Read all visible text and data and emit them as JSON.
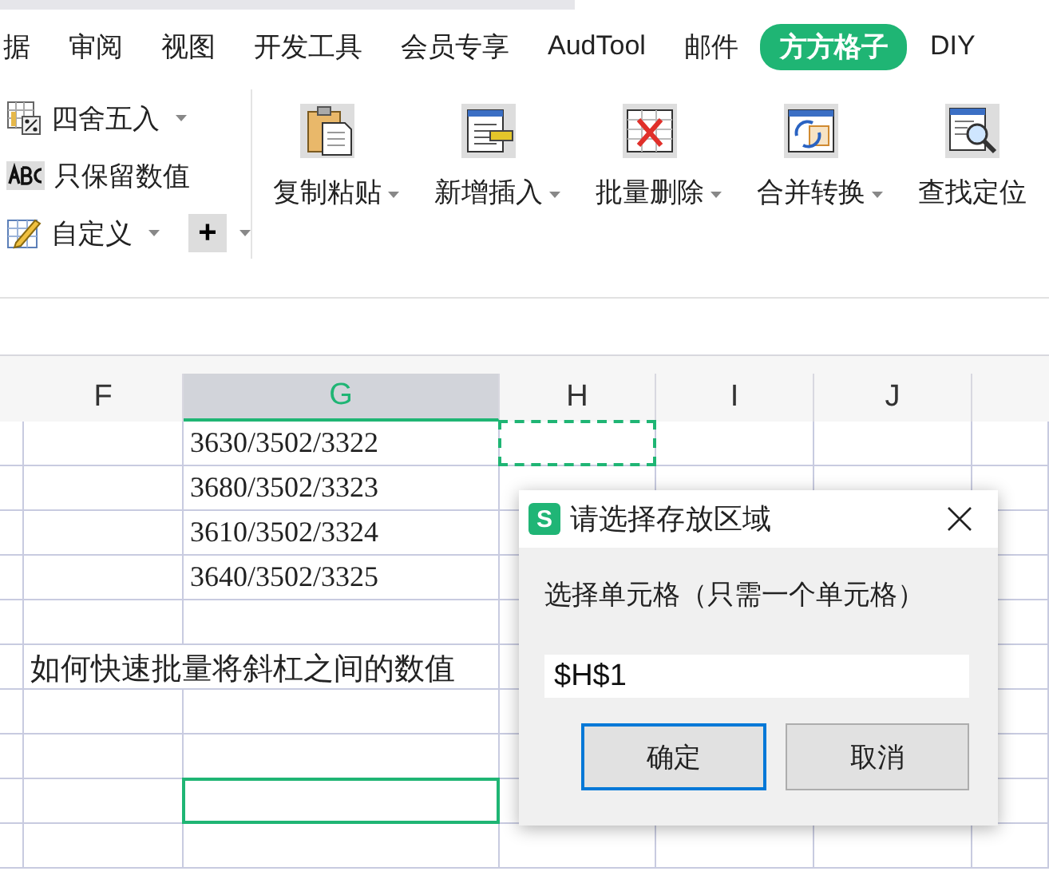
{
  "ribbon_tabs": [
    {
      "label": "据",
      "selected": false
    },
    {
      "label": "审阅",
      "selected": false
    },
    {
      "label": "视图",
      "selected": false
    },
    {
      "label": "开发工具",
      "selected": false
    },
    {
      "label": "会员专享",
      "selected": false
    },
    {
      "label": "AudTool",
      "selected": false
    },
    {
      "label": "邮件",
      "selected": false
    },
    {
      "label": "方方格子",
      "selected": true
    },
    {
      "label": "DIY",
      "selected": false
    }
  ],
  "ribbon": {
    "small_buttons": [
      {
        "label": "四舍五入",
        "dropdown": true
      },
      {
        "label": "只保留数值",
        "dropdown": false
      },
      {
        "label": "自定义",
        "dropdown": true
      }
    ],
    "add_button": {
      "label": "+",
      "dropdown": true
    },
    "big_buttons": [
      {
        "label": "复制粘贴",
        "dropdown": true
      },
      {
        "label": "新增插入",
        "dropdown": true
      },
      {
        "label": "批量删除",
        "dropdown": true
      },
      {
        "label": "合并转换",
        "dropdown": true
      },
      {
        "label": "查找定位",
        "dropdown": false
      }
    ]
  },
  "sheet": {
    "columns": [
      {
        "label": "F",
        "selected": false
      },
      {
        "label": "G",
        "selected": true
      },
      {
        "label": "H",
        "selected": false
      },
      {
        "label": "I",
        "selected": false
      },
      {
        "label": "J",
        "selected": false
      }
    ],
    "rows": [
      {
        "G": {
          "text": "3630/3502/3322"
        },
        "H": {
          "marquee": true
        }
      },
      {
        "G": {
          "text": "3680/3502/3323"
        }
      },
      {
        "G": {
          "text": "3610/3502/3324"
        }
      },
      {
        "G": {
          "text": "3640/3502/3325"
        }
      },
      {},
      {
        "F": {
          "text": "如何快速批量将斜杠之间的数值"
        }
      },
      {},
      {},
      {
        "G": {
          "selected": true
        }
      },
      {}
    ]
  },
  "dialog": {
    "icon_letter": "S",
    "title": "请选择存放区域",
    "label": "选择单元格（只需一个单元格）",
    "value": "$H$1",
    "buttons": [
      {
        "label": "确定",
        "default": true
      },
      {
        "label": "取消",
        "default": false
      }
    ]
  }
}
